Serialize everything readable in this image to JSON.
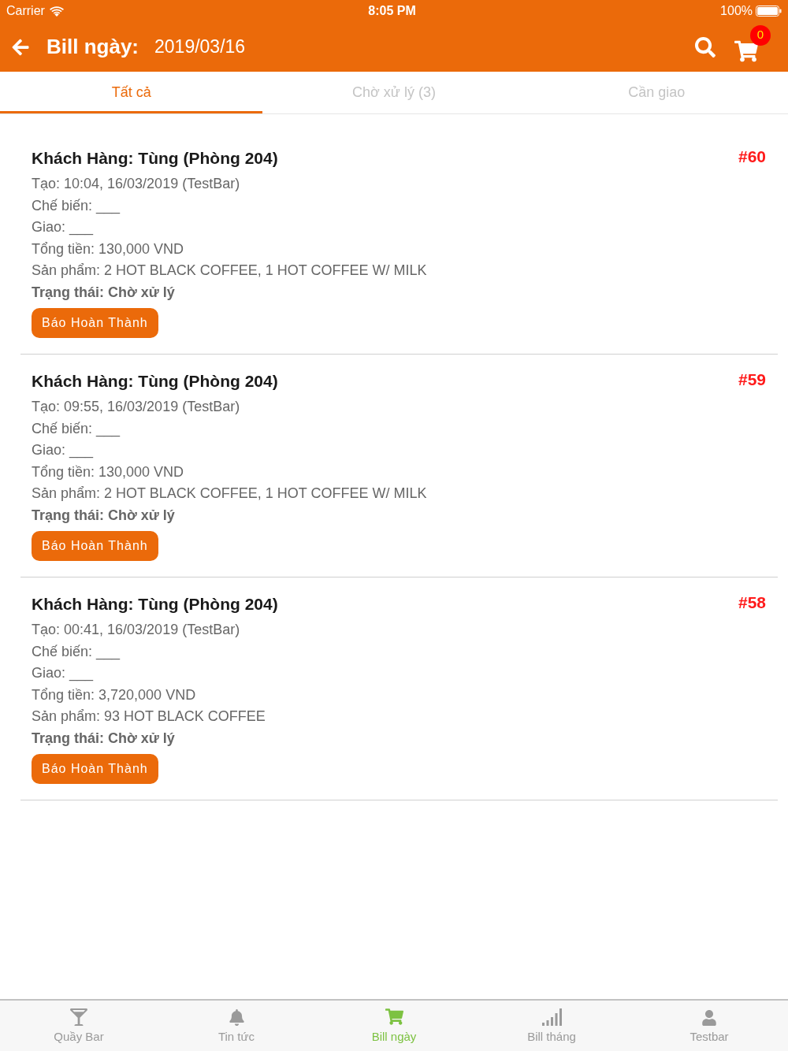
{
  "status_bar": {
    "carrier": "Carrier",
    "time": "8:05 PM",
    "battery": "100%"
  },
  "header": {
    "title": "Bill ngày:",
    "date": "2019/03/16",
    "cart_badge": "0"
  },
  "tabs": [
    {
      "label": "Tất cả",
      "selected": true
    },
    {
      "label": "Chờ xử lý (3)",
      "selected": false
    },
    {
      "label": "Cần giao",
      "selected": false
    }
  ],
  "orders": [
    {
      "customer": "Khách Hàng: Tùng (Phòng 204)",
      "number": "#60",
      "details": [
        "Tạo: 10:04, 16/03/2019 (TestBar)",
        "Chế biến: ___",
        "Giao: ___",
        "Tổng tiền: 130,000 VND",
        "Sản phẩm: 2 HOT BLACK COFFEE, 1 HOT COFFEE W/ MILK"
      ],
      "status": "Trạng thái: Chờ xử lý",
      "button": "Báo Hoàn Thành"
    },
    {
      "customer": "Khách Hàng: Tùng (Phòng 204)",
      "number": "#59",
      "details": [
        "Tạo: 09:55, 16/03/2019 (TestBar)",
        "Chế biến: ___",
        "Giao: ___",
        "Tổng tiền: 130,000 VND",
        "Sản phẩm: 2 HOT BLACK COFFEE, 1 HOT COFFEE W/ MILK"
      ],
      "status": "Trạng thái: Chờ xử lý",
      "button": "Báo Hoàn Thành"
    },
    {
      "customer": "Khách Hàng: Tùng (Phòng 204)",
      "number": "#58",
      "details": [
        "Tạo: 00:41, 16/03/2019 (TestBar)",
        "Chế biến: ___",
        "Giao: ___",
        "Tổng tiền: 3,720,000 VND",
        "Sản phẩm: 93 HOT BLACK COFFEE"
      ],
      "status": "Trạng thái: Chờ xử lý",
      "button": "Báo Hoàn Thành"
    }
  ],
  "bottom_nav": [
    {
      "label": "Quầy Bar",
      "selected": false
    },
    {
      "label": "Tin tức",
      "selected": false
    },
    {
      "label": "Bill ngày",
      "selected": true
    },
    {
      "label": "Bill tháng",
      "selected": false
    },
    {
      "label": "Testbar",
      "selected": false
    }
  ]
}
